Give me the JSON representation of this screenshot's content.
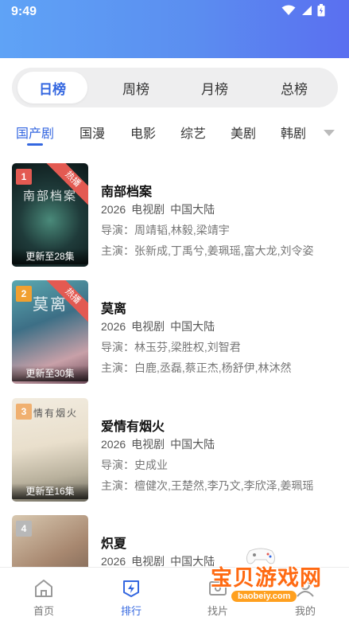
{
  "status_bar": {
    "time": "9:49"
  },
  "period_tabs": [
    {
      "label": "日榜",
      "active": true
    },
    {
      "label": "周榜",
      "active": false
    },
    {
      "label": "月榜",
      "active": false
    },
    {
      "label": "总榜",
      "active": false
    }
  ],
  "categories": [
    {
      "label": "国产剧",
      "active": true
    },
    {
      "label": "国漫",
      "active": false
    },
    {
      "label": "电影",
      "active": false
    },
    {
      "label": "综艺",
      "active": false
    },
    {
      "label": "美剧",
      "active": false
    },
    {
      "label": "韩剧",
      "active": false
    }
  ],
  "items": [
    {
      "rank": "1",
      "hot_label": "热播",
      "poster_text": "南部档案",
      "update": "更新至28集",
      "title": "南部档案",
      "year": "2026",
      "type": "电视剧",
      "region": "中国大陆",
      "director": "导演：周靖韬,林毅,梁靖宇",
      "cast": "主演：张新成,丁禹兮,姜珮瑶,富大龙,刘令姿"
    },
    {
      "rank": "2",
      "hot_label": "热播",
      "poster_text": "莫离",
      "update": "更新至30集",
      "title": "莫离",
      "year": "2026",
      "type": "电视剧",
      "region": "中国大陆",
      "director": "导演：林玉芬,梁胜权,刘智君",
      "cast": "主演：白鹿,丞磊,蔡正杰,杨舒伊,林沐然"
    },
    {
      "rank": "3",
      "hot_label": "",
      "poster_text": "爱情有烟火",
      "update": "更新至16集",
      "title": "爱情有烟火",
      "year": "2026",
      "type": "电视剧",
      "region": "中国大陆",
      "director": "导演：史成业",
      "cast": "主演：檀健次,王楚然,李乃文,李欣泽,姜珮瑶"
    },
    {
      "rank": "4",
      "hot_label": "",
      "poster_text": "",
      "update": "",
      "title": "炽夏",
      "year": "2026",
      "type": "电视剧",
      "region": "中国大陆",
      "director": "",
      "cast": ""
    }
  ],
  "bottom_nav": [
    {
      "label": "首页",
      "icon": "home-icon",
      "active": false
    },
    {
      "label": "排行",
      "icon": "ranking-icon",
      "active": true
    },
    {
      "label": "找片",
      "icon": "find-icon",
      "active": false
    },
    {
      "label": "我的",
      "icon": "profile-icon",
      "active": false
    }
  ],
  "watermark": {
    "text": "宝贝游戏网",
    "url": "baobeiy.com"
  },
  "colors": {
    "accent": "#3467e0",
    "rank_1": "#e35a52",
    "rank_2": "#f0a030",
    "rank_3": "#f0b070",
    "rank_4": "#b8b8b8"
  }
}
